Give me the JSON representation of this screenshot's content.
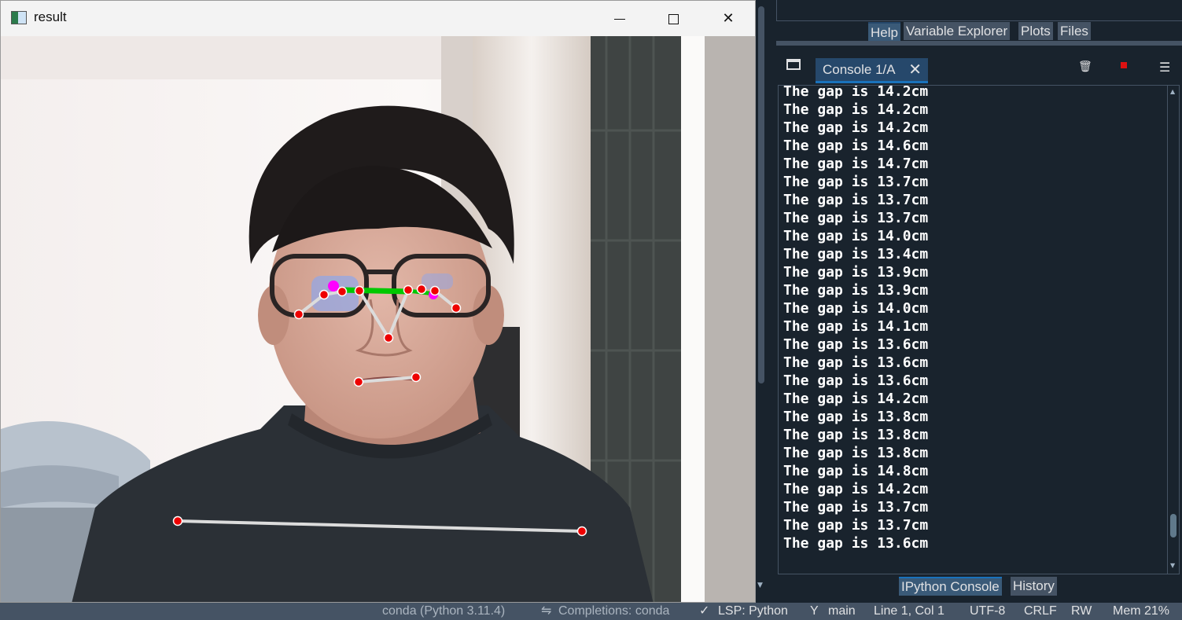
{
  "result_window": {
    "title": "result",
    "minimize_glyph": "",
    "maximize_glyph": "",
    "close_glyph": "✕"
  },
  "right_pane": {
    "top_tabs": [
      "Help",
      "Variable Explorer",
      "Plots",
      "Files"
    ],
    "active_top_tab": "Help",
    "console_tab": {
      "label": "Console 1/A",
      "close_glyph": "✕"
    },
    "console_lines": [
      "The gap is 14.2cm",
      "The gap is 14.2cm",
      "The gap is 14.2cm",
      "The gap is 14.6cm",
      "The gap is 14.7cm",
      "The gap is 13.7cm",
      "The gap is 13.7cm",
      "The gap is 13.7cm",
      "The gap is 14.0cm",
      "The gap is 13.4cm",
      "The gap is 13.9cm",
      "The gap is 13.9cm",
      "The gap is 14.0cm",
      "The gap is 14.1cm",
      "The gap is 13.6cm",
      "The gap is 13.6cm",
      "The gap is 13.6cm",
      "The gap is 14.2cm",
      "The gap is 13.8cm",
      "The gap is 13.8cm",
      "The gap is 13.8cm",
      "The gap is 14.8cm",
      "The gap is 14.2cm",
      "The gap is 13.7cm",
      "The gap is 13.7cm",
      "The gap is 13.6cm"
    ],
    "bottom_tabs": [
      "IPython Console",
      "History"
    ],
    "active_bottom_tab": "IPython Console"
  },
  "statusbar": {
    "env": "conda (Python 3.11.4)",
    "completions": "Completions: conda",
    "lsp": "LSP: Python",
    "branch": "main",
    "cursor": "Line 1, Col 1",
    "encoding": "UTF-8",
    "eol": "CRLF",
    "mode": "RW",
    "mem": "Mem 21%"
  },
  "colors": {
    "console_bg": "#19232d",
    "tab_bg": "#455364",
    "keypoint": "#ff0000",
    "skeleton": "#dcdcdc",
    "eye_link": "#00c800",
    "iris": "#ff00ff"
  },
  "icons": {
    "app": "opencv-window-icon",
    "options": "window-options-icon",
    "trash": "trash-icon",
    "stop": "stop-icon",
    "menu": "hamburger-menu-icon",
    "git": "git-branch-icon",
    "lsp_check": "check-icon"
  }
}
